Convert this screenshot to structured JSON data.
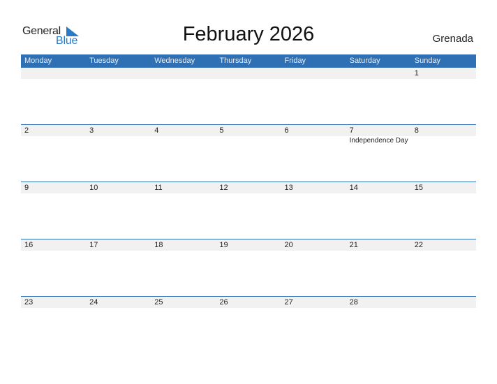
{
  "logo": {
    "word1": "General",
    "word2": "Blue"
  },
  "title": "February 2026",
  "country": "Grenada",
  "colors": {
    "header": "#2e70b3",
    "accent": "#2a7ac7",
    "daybar": "#f1f1f1"
  },
  "weekdays": [
    "Monday",
    "Tuesday",
    "Wednesday",
    "Thursday",
    "Friday",
    "Saturday",
    "Sunday"
  ],
  "weeks": [
    {
      "days": [
        "",
        "",
        "",
        "",
        "",
        "",
        "1"
      ],
      "events": [
        "",
        "",
        "",
        "",
        "",
        "",
        ""
      ]
    },
    {
      "days": [
        "2",
        "3",
        "4",
        "5",
        "6",
        "7",
        "8"
      ],
      "events": [
        "",
        "",
        "",
        "",
        "",
        "Independence Day",
        ""
      ]
    },
    {
      "days": [
        "9",
        "10",
        "11",
        "12",
        "13",
        "14",
        "15"
      ],
      "events": [
        "",
        "",
        "",
        "",
        "",
        "",
        ""
      ]
    },
    {
      "days": [
        "16",
        "17",
        "18",
        "19",
        "20",
        "21",
        "22"
      ],
      "events": [
        "",
        "",
        "",
        "",
        "",
        "",
        ""
      ]
    },
    {
      "days": [
        "23",
        "24",
        "25",
        "26",
        "27",
        "28",
        ""
      ],
      "events": [
        "",
        "",
        "",
        "",
        "",
        "",
        ""
      ]
    }
  ]
}
